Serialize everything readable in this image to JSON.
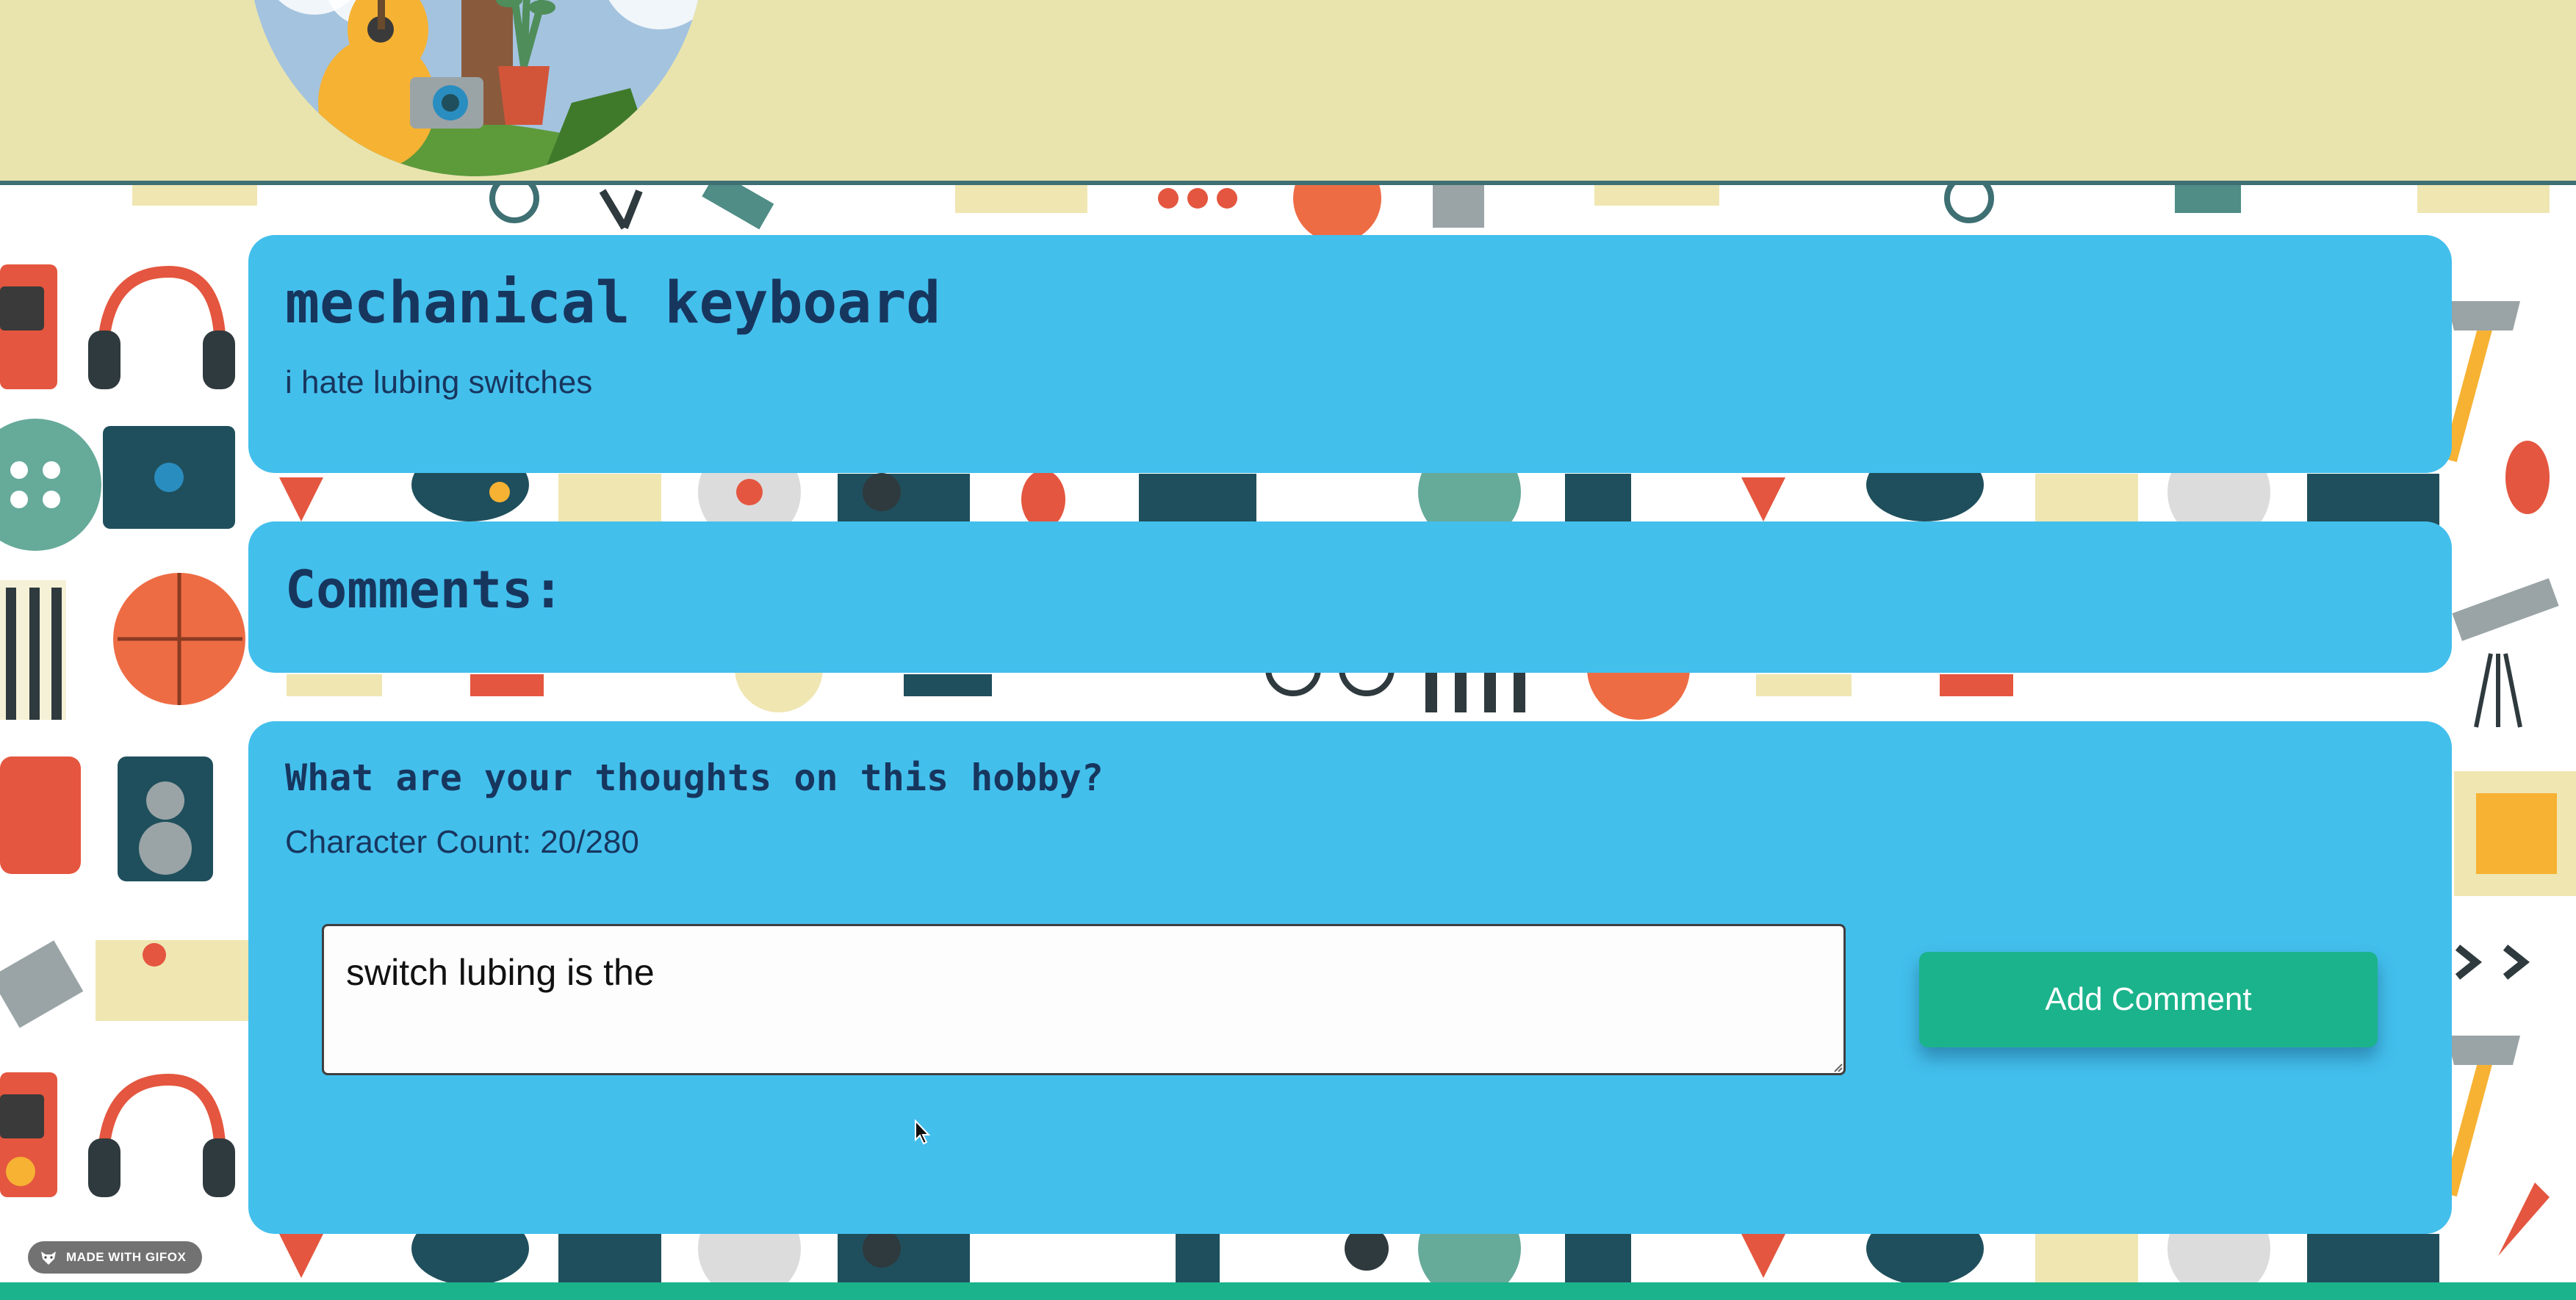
{
  "header": {
    "logo_icon": "hobby-collage-logo"
  },
  "hobby": {
    "title": "mechanical keyboard",
    "description": "i hate lubing switches"
  },
  "comments": {
    "heading": "Comments:"
  },
  "comment_form": {
    "prompt": "What are your thoughts on this hobby?",
    "char_count_label": "Character Count:",
    "char_count_value": "20/280",
    "input_value": "switch lubing is the",
    "submit_label": "Add Comment"
  },
  "watermark": {
    "label": "MADE WITH GIFOX"
  },
  "colors": {
    "header_bg": "#e9e4ad",
    "card_bg": "#43bfec",
    "text": "#17365e",
    "accent": "#1bb38b"
  }
}
